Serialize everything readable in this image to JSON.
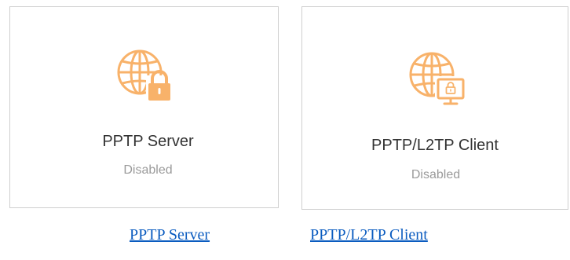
{
  "accent_color": "#f8b26a",
  "cards": [
    {
      "title": "PPTP Server",
      "status": "Disabled",
      "icon": "globe-lock-icon"
    },
    {
      "title": "PPTP/L2TP Client",
      "status": "Disabled",
      "icon": "globe-monitor-lock-icon"
    }
  ],
  "links": [
    {
      "label": "PPTP Server"
    },
    {
      "label": "PPTP/L2TP Client"
    }
  ]
}
